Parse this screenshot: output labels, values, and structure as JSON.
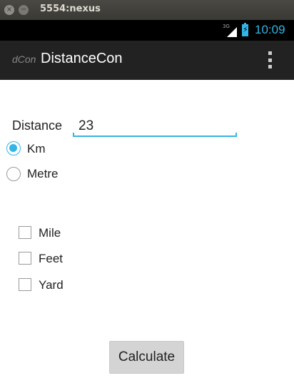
{
  "window": {
    "title": "5554:nexus",
    "close_icon": "×",
    "minimize_icon": "−"
  },
  "statusbar": {
    "network": "3G",
    "time": "10:09",
    "colors": {
      "accent": "#33b5e5"
    }
  },
  "actionbar": {
    "app_icon_text": "dCon",
    "title": "DistanceCon"
  },
  "form": {
    "distance_label": "Distance",
    "distance_value": "23",
    "radios": [
      {
        "label": "Km",
        "checked": true
      },
      {
        "label": "Metre",
        "checked": false
      }
    ],
    "checkboxes": [
      {
        "label": "Mile",
        "checked": false
      },
      {
        "label": "Feet",
        "checked": false
      },
      {
        "label": "Yard",
        "checked": false
      }
    ],
    "calculate_label": "Calculate"
  }
}
